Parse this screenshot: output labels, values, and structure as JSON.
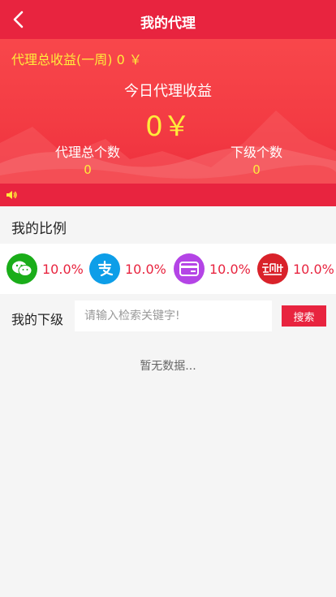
{
  "header": {
    "title": "我的代理",
    "back_icon": "chevron-left-icon"
  },
  "banner": {
    "week_label": "代理总收益(一周) 0 ￥",
    "today_label": "今日代理收益",
    "today_value": "0￥",
    "total_agents_label": "代理总个数",
    "total_agents_value": "0",
    "sub_count_label": "下级个数",
    "sub_count_value": "0"
  },
  "notice": {
    "icon": "speaker-icon"
  },
  "ratio": {
    "title": "我的比例",
    "items": [
      {
        "icon": "wechat-icon",
        "value": "10.0%"
      },
      {
        "icon": "alipay-icon",
        "value": "10.0%"
      },
      {
        "icon": "card-icon",
        "value": "10.0%"
      },
      {
        "icon": "unionpay-cloud-icon",
        "value": "10.0%"
      }
    ]
  },
  "subordinates": {
    "label": "我的下级",
    "search_placeholder": "请输入检索关键字!",
    "search_button": "搜索",
    "empty_text": "暂无数据..."
  },
  "colors": {
    "accent": "#e8243f",
    "highlight": "#ffeb3b"
  }
}
